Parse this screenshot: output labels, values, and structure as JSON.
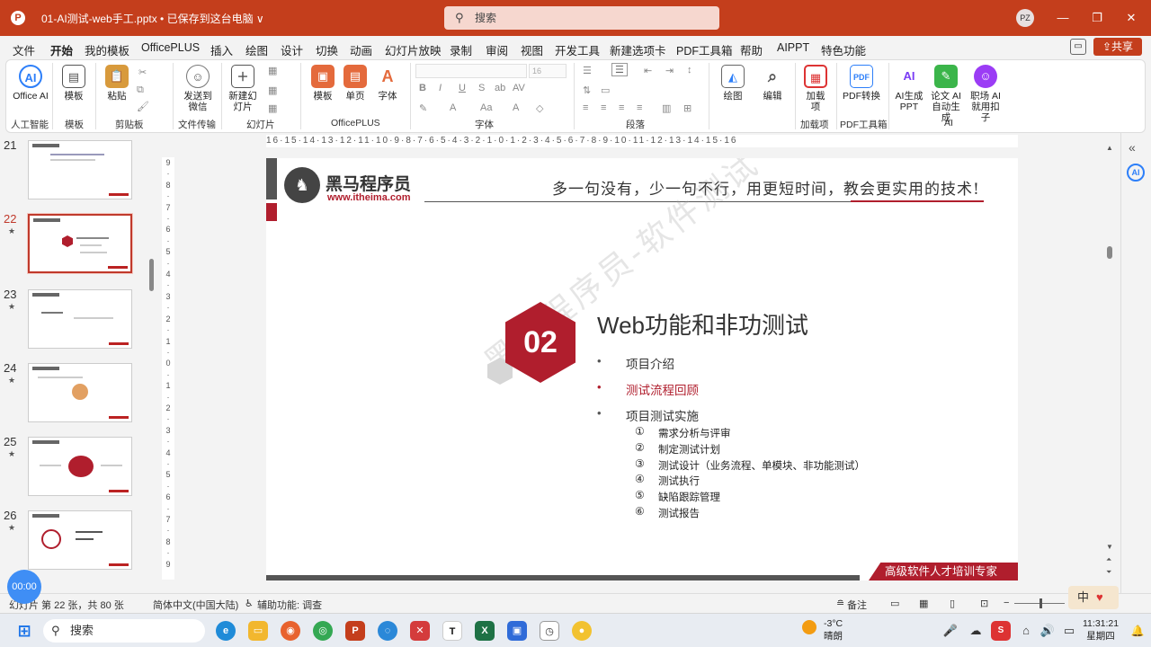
{
  "title_bar": {
    "document_title": "01-AI测试-web手工.pptx • 已保存到这台电脑 ∨",
    "search_placeholder": "搜索",
    "avatar": "PZ",
    "minimize": "—",
    "restore": "❐",
    "close": "✕"
  },
  "menu": {
    "items": [
      "文件",
      "开始",
      "我的模板",
      "OfficePLUS",
      "插入",
      "绘图",
      "设计",
      "切换",
      "动画",
      "幻灯片放映",
      "录制",
      "审阅",
      "视图",
      "开发工具",
      "新建选项卡",
      "PDF工具箱",
      "帮助",
      "AIPPT",
      "特色功能"
    ],
    "active": "开始",
    "share": "共享"
  },
  "ribbon": {
    "office_ai": "Office AI",
    "template": "模板",
    "paste": "粘贴",
    "send_wechat": "发送到微信",
    "new_slide": "新建幻灯片",
    "officeplus_template": "模板",
    "single_page": "单页",
    "font_btn": "字体",
    "draw": "绘图",
    "edit": "编辑",
    "addin": "加载项",
    "pdf_convert": "PDF转换",
    "ai_ppt": "AI生成PPT",
    "lunwen_ai": "论文 AI 自动生成",
    "zhichang_ai": "职场 AI 就用扣子",
    "font_size": "16",
    "groups": [
      "人工智能",
      "模板",
      "剪贴板",
      "文件传输",
      "幻灯片",
      "OfficePLUS",
      "字体",
      "段落",
      "加载项",
      "PDF工具箱",
      "AI"
    ]
  },
  "thumbnails": {
    "numbers": [
      "21",
      "22",
      "23",
      "24",
      "25",
      "26"
    ],
    "selected": "22"
  },
  "ruler": {
    "horizontal": "16·15·14·13·12·11·10·9·8·7·6·5·4·3·2·1·0·1·2·3·4·5·6·7·8·9·10·11·12·13·14·15·16",
    "vertical": [
      "9",
      "8",
      "7",
      "6",
      "5",
      "4",
      "3",
      "2",
      "1",
      "0",
      "1",
      "2",
      "3",
      "4",
      "5",
      "6",
      "7",
      "8",
      "9"
    ]
  },
  "slide": {
    "logo_name": "黑马程序员",
    "logo_url": "www.itheima.com",
    "slogan": "多一句没有，少一句不行，用更短时间，教会更实用的技术!",
    "section_number": "02",
    "title": "Web功能和非功测试",
    "bullets": [
      {
        "text": "项目介绍",
        "highlight": false
      },
      {
        "text": "测试流程回顾",
        "highlight": true
      },
      {
        "text": "项目测试实施",
        "highlight": false
      }
    ],
    "sub_items": [
      {
        "num": "①",
        "text": "需求分析与评审"
      },
      {
        "num": "②",
        "text": "制定测试计划"
      },
      {
        "num": "③",
        "text": "测试设计（业务流程、单模块、非功能测试）"
      },
      {
        "num": "④",
        "text": "测试执行"
      },
      {
        "num": "⑤",
        "text": "缺陷跟踪管理"
      },
      {
        "num": "⑥",
        "text": "测试报告"
      }
    ],
    "watermark": "黑马程序员-软件测试",
    "footer": "高级软件人才培训专家"
  },
  "status": {
    "slide_info": "幻灯片 第 22 张，共 80 张",
    "language": "简体中文(中国大陆)",
    "accessibility": "辅助功能: 调查",
    "notes": "备注",
    "timer": "00:00",
    "ime": "中"
  },
  "taskbar": {
    "search": "搜索",
    "temp": "-3°C",
    "weather": "晴朗",
    "time": "11:31:21",
    "weekday": "星期四"
  }
}
